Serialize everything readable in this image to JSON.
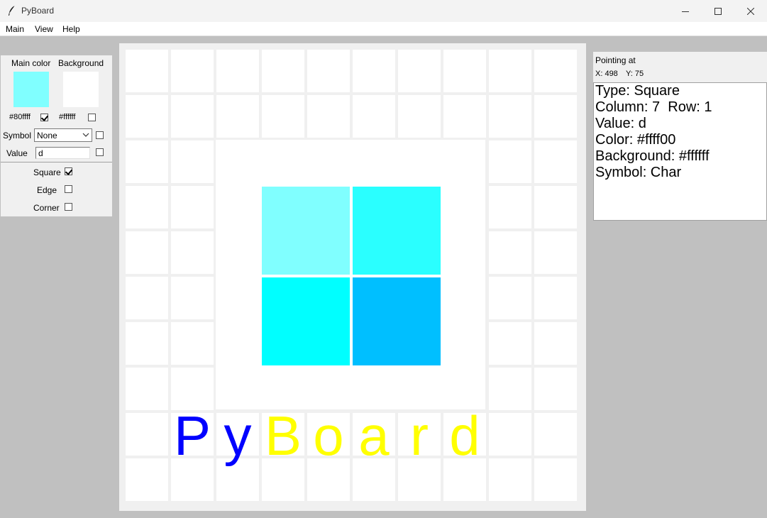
{
  "window": {
    "title": "PyBoard"
  },
  "menu": [
    "Main",
    "View",
    "Help"
  ],
  "left_panel": {
    "main_color_label": "Main color",
    "background_label": "Background",
    "main_color": "#80ffff",
    "background_color": "#ffffff",
    "main_color_hex": "#80ffff",
    "background_hex": "#ffffff",
    "main_color_checked": true,
    "background_checked": false,
    "symbol_label": "Symbol",
    "symbol_value": "None",
    "value_label": "Value",
    "value_text": "d",
    "square_label": "Square",
    "square_checked": true,
    "edge_label": "Edge",
    "edge_checked": false,
    "corner_label": "Corner",
    "corner_checked": false
  },
  "board": {
    "grid_rows": 10,
    "grid_cols": 10,
    "squares": [
      {
        "color": "#80ffff"
      },
      {
        "color": "#2affff"
      },
      {
        "color": "#00ffff"
      },
      {
        "color": "#00bfff"
      }
    ],
    "title_letters": [
      {
        "char": "P",
        "color": "#0000ff"
      },
      {
        "char": "y",
        "color": "#0000ff"
      },
      {
        "char": "B",
        "color": "#ffff00"
      },
      {
        "char": "o",
        "color": "#ffff00"
      },
      {
        "char": "a",
        "color": "#ffff00"
      },
      {
        "char": "r",
        "color": "#ffff00"
      },
      {
        "char": "d",
        "color": "#ffff00"
      }
    ]
  },
  "right_panel": {
    "heading": "Pointing at",
    "x_text": "X: 498",
    "y_text": "Y: 75",
    "info_lines": [
      "Type: Square",
      "Column: 7  Row: 1",
      "Value: d",
      "Color: #ffff00",
      "Background: #ffffff",
      "Symbol: Char"
    ]
  }
}
